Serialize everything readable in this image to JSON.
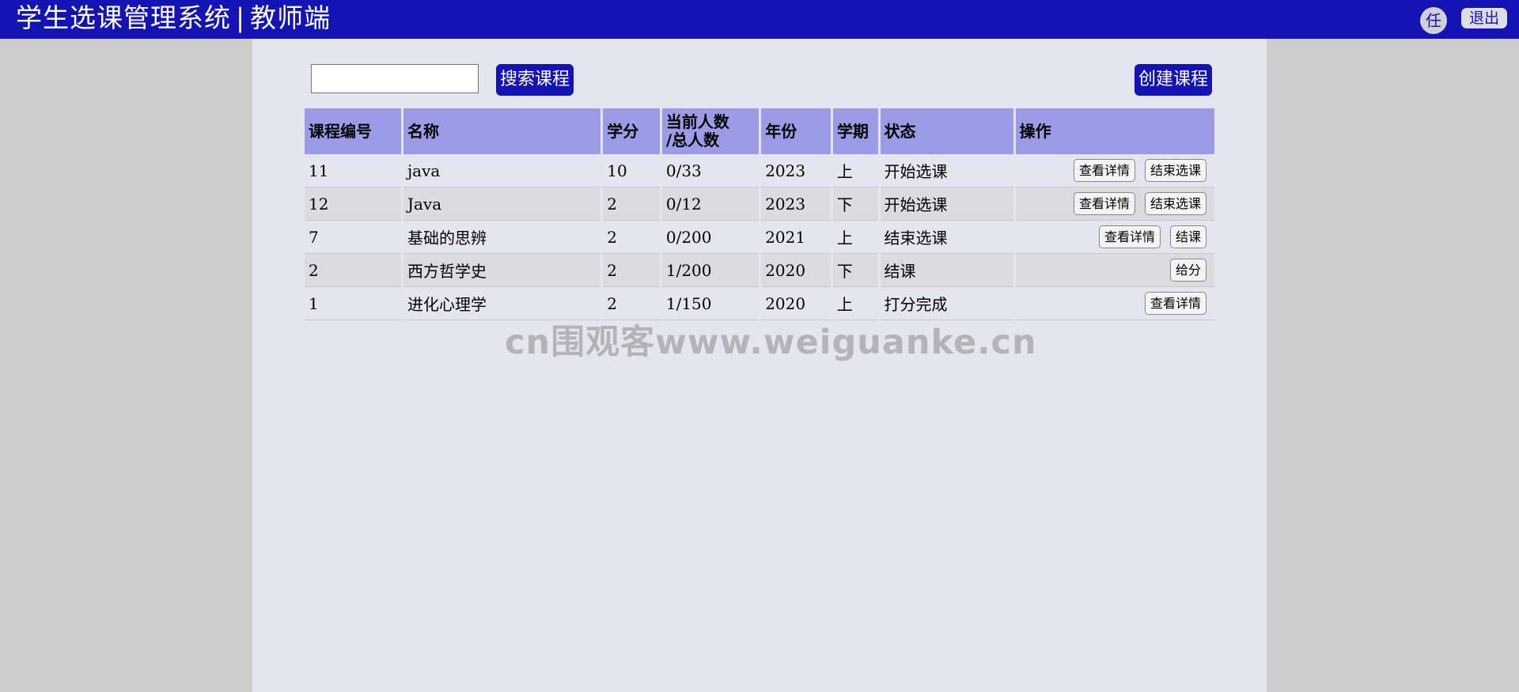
{
  "header": {
    "title": "学生选课管理系统",
    "separator": "|",
    "role": "教师端",
    "avatar_text": "任",
    "logout_label": "退出"
  },
  "toolbar": {
    "search_value": "",
    "search_label": "搜索课程",
    "create_label": "创建课程"
  },
  "table": {
    "columns": [
      "课程编号",
      "名称",
      "学分",
      "当前人数",
      "/总人数",
      "年份",
      "学期",
      "状态",
      "操作"
    ],
    "rows": [
      {
        "id": "11",
        "name": "java",
        "credit": "10",
        "count": "0/33",
        "year": "2023",
        "term": "上",
        "status": "开始选课",
        "actions": [
          "查看详情",
          "结束选课"
        ]
      },
      {
        "id": "12",
        "name": "Java",
        "credit": "2",
        "count": "0/12",
        "year": "2023",
        "term": "下",
        "status": "开始选课",
        "actions": [
          "查看详情",
          "结束选课"
        ]
      },
      {
        "id": "7",
        "name": "基础的思辨",
        "credit": "2",
        "count": "0/200",
        "year": "2021",
        "term": "上",
        "status": "结束选课",
        "actions": [
          "查看详情",
          "结课"
        ]
      },
      {
        "id": "2",
        "name": "西方哲学史",
        "credit": "2",
        "count": "1/200",
        "year": "2020",
        "term": "下",
        "status": "结课",
        "actions": [
          "给分"
        ]
      },
      {
        "id": "1",
        "name": "进化心理学",
        "credit": "2",
        "count": "1/150",
        "year": "2020",
        "term": "上",
        "status": "打分完成",
        "actions": [
          "查看详情"
        ]
      }
    ]
  },
  "watermark": "cn围观客www.weiguanke.cn",
  "colors": {
    "header_bg": "#1414b4",
    "page_bg": "#cccccc",
    "content_bg": "#e5e5f0",
    "table_header_bg": "#9b9be6",
    "row_alt_bg": "#dcdce0"
  }
}
